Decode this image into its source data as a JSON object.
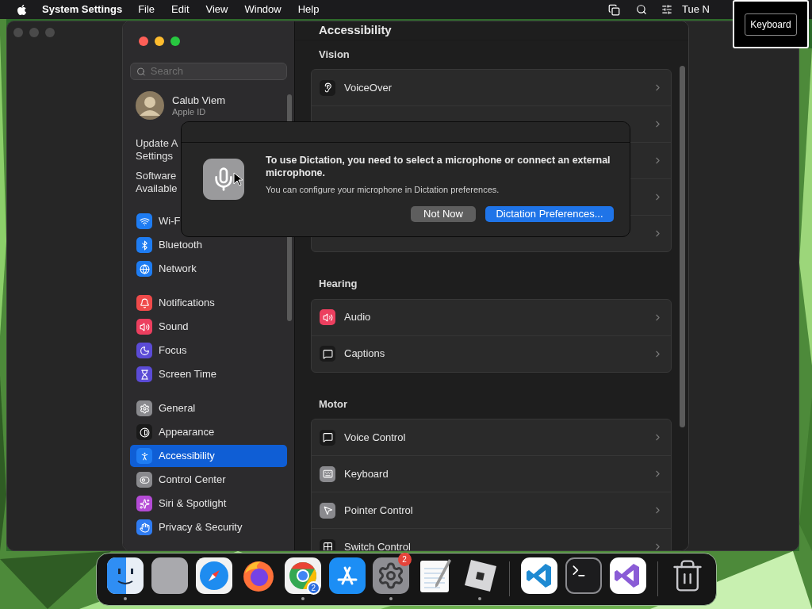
{
  "menu_bar": {
    "app": "System Settings",
    "menus": [
      "File",
      "Edit",
      "View",
      "Window",
      "Help"
    ],
    "clock": "Tue N"
  },
  "keystroke_overlay": {
    "key": "Keyboard"
  },
  "sidebar": {
    "search": {
      "placeholder": "Search"
    },
    "account": {
      "name": "Calub Viem",
      "subtitle": "Apple ID"
    },
    "notices": [
      {
        "lines": [
          "Update A",
          "Settings"
        ]
      },
      {
        "lines": [
          "Software",
          "Available"
        ]
      }
    ],
    "groups": [
      [
        {
          "kind": "wifi",
          "label": "Wi-F",
          "selected": false
        },
        {
          "kind": "bluetooth",
          "label": "Bluetooth",
          "selected": false
        },
        {
          "kind": "network",
          "label": "Network",
          "selected": false
        }
      ],
      [
        {
          "kind": "notifications",
          "label": "Notifications",
          "selected": false
        },
        {
          "kind": "sound",
          "label": "Sound",
          "selected": false
        },
        {
          "kind": "focus",
          "label": "Focus",
          "selected": false
        },
        {
          "kind": "screentime",
          "label": "Screen Time",
          "selected": false
        }
      ],
      [
        {
          "kind": "general",
          "label": "General",
          "selected": false
        },
        {
          "kind": "appearance",
          "label": "Appearance",
          "selected": false
        },
        {
          "kind": "accessibility",
          "label": "Accessibility",
          "selected": true
        },
        {
          "kind": "controlcenter",
          "label": "Control Center",
          "selected": false
        },
        {
          "kind": "siri",
          "label": "Siri & Spotlight",
          "selected": false
        },
        {
          "kind": "privacy",
          "label": "Privacy & Security",
          "selected": false
        }
      ]
    ]
  },
  "content": {
    "title": "Accessibility",
    "sections": [
      {
        "heading": "Vision",
        "rows": [
          {
            "kind": "voiceover",
            "label": "VoiceOver"
          },
          {
            "kind": "covered"
          },
          {
            "kind": "covered"
          },
          {
            "kind": "covered"
          },
          {
            "kind": "covered"
          }
        ]
      },
      {
        "heading": "Hearing",
        "rows": [
          {
            "kind": "audio",
            "label": "Audio"
          },
          {
            "kind": "captions",
            "label": "Captions"
          }
        ]
      },
      {
        "heading": "Motor",
        "rows": [
          {
            "kind": "voicecontrol",
            "label": "Voice Control"
          },
          {
            "kind": "keyboard",
            "label": "Keyboard"
          },
          {
            "kind": "pointer",
            "label": "Pointer Control"
          },
          {
            "kind": "switch",
            "label": "Switch Control"
          }
        ]
      }
    ]
  },
  "dialog": {
    "title": "To use Dictation, you need to select a microphone or connect an external microphone.",
    "message": "You can configure your microphone in Dictation preferences.",
    "buttons": [
      {
        "label": "Not Now",
        "default": false
      },
      {
        "label": "Dictation Preferences...",
        "default": true
      }
    ]
  },
  "dock": {
    "groups": [
      [
        {
          "kind": "finder",
          "running": true
        },
        {
          "kind": "launchpad",
          "running": false
        },
        {
          "kind": "safari",
          "running": false
        },
        {
          "kind": "firefox",
          "running": false
        },
        {
          "kind": "chrome",
          "running": true,
          "badge": {
            "text": "2",
            "color": "#2f6fe0"
          }
        },
        {
          "kind": "appstore",
          "running": false
        },
        {
          "kind": "settings",
          "running": true,
          "badge": {
            "text": "2",
            "color": "#e5443a"
          }
        },
        {
          "kind": "textedit",
          "running": false
        },
        {
          "kind": "roblox",
          "running": true
        }
      ],
      [
        {
          "kind": "vscode",
          "running": false
        },
        {
          "kind": "terminal",
          "running": false
        },
        {
          "kind": "visualstudio",
          "running": false
        }
      ],
      [
        {
          "kind": "trash",
          "running": false
        }
      ]
    ]
  }
}
